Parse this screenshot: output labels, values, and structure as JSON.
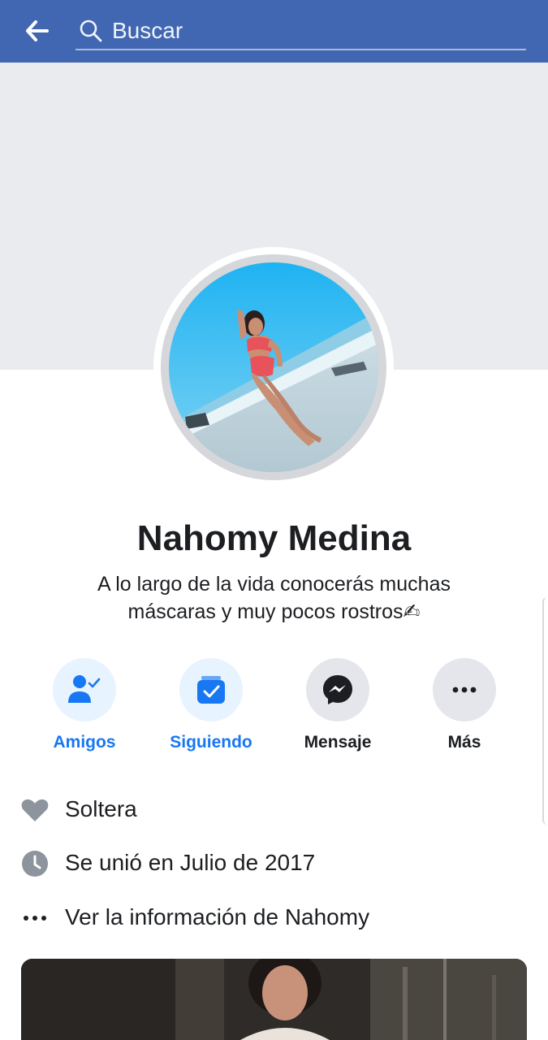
{
  "header": {
    "search_placeholder": "Buscar",
    "color": "#4267b2"
  },
  "profile": {
    "name": "Nahomy Medina",
    "bio_line1": "A lo largo de la vida conocerás muchas",
    "bio_line2": "máscaras y muy pocos rostros✍"
  },
  "actions": [
    {
      "label": "Amigos",
      "icon": "friends-check-icon",
      "active": true
    },
    {
      "label": "Siguiendo",
      "icon": "following-check-icon",
      "active": true
    },
    {
      "label": "Mensaje",
      "icon": "messenger-icon",
      "active": false
    },
    {
      "label": "Más",
      "icon": "more-dots-icon",
      "active": false
    }
  ],
  "info": [
    {
      "icon": "heart-icon",
      "text": "Soltera"
    },
    {
      "icon": "clock-icon",
      "text": "Se unió en Julio de 2017"
    },
    {
      "icon": "more-dots-icon",
      "text": "Ver la información de Nahomy"
    }
  ],
  "colors": {
    "accent": "#1877f2",
    "cover": "#e9ebee",
    "text": "#1c1e21"
  }
}
